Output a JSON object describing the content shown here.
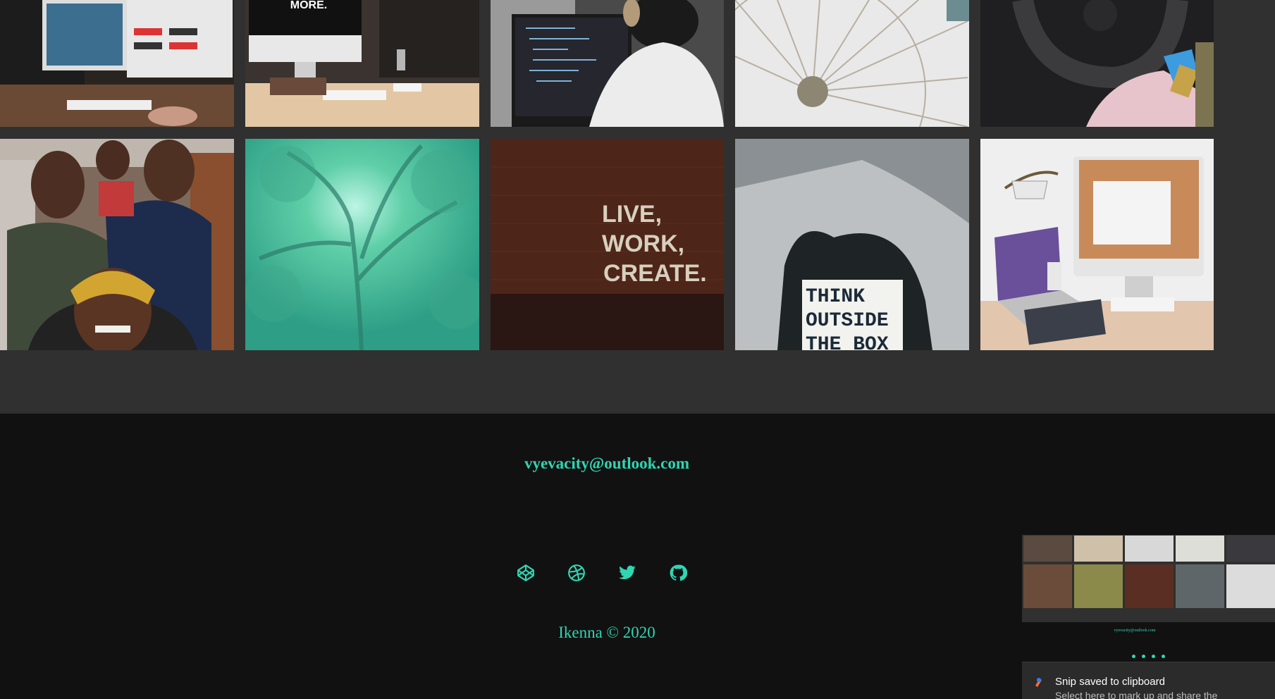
{
  "gallery": {
    "tiles": [
      {
        "name": "photo-dual-monitor-coding"
      },
      {
        "name": "photo-imac-do-more"
      },
      {
        "name": "photo-developer-headphones"
      },
      {
        "name": "photo-ferris-wheel"
      },
      {
        "name": "photo-car-steering-wheel"
      },
      {
        "name": "photo-group-selfie"
      },
      {
        "name": "photo-green-tree"
      },
      {
        "name": "photo-live-work-create-wall",
        "text_lines": [
          "LIVE,",
          "WORK,",
          "CREATE."
        ]
      },
      {
        "name": "photo-think-outside-the-box",
        "text_lines": [
          "THINK",
          "OUTSIDE",
          "THE BOX"
        ]
      },
      {
        "name": "photo-imac-laptop-desk"
      }
    ],
    "imac_text": "MORE."
  },
  "footer": {
    "email": "vyevacity@outlook.com",
    "social_icons": [
      "codepen-icon",
      "dribbble-icon",
      "twitter-icon",
      "github-icon"
    ],
    "copyright": "Ikenna © 2020"
  },
  "toast": {
    "title": "Snip saved to clipboard",
    "subtitle": "Select here to mark up and share the"
  },
  "colors": {
    "accent": "#2fd6b2",
    "footer_bg": "#111111",
    "gallery_bg": "#303030"
  }
}
